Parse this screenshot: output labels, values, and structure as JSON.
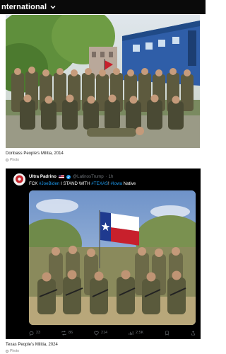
{
  "header": {
    "title": "nternational"
  },
  "post1": {
    "caption": "Donbass People's Militia, 2014",
    "type_label": "Photo"
  },
  "tweet": {
    "display_name": "Ultra Padrino",
    "handle": "@LatinosTrump",
    "time": "· 1h",
    "text_prefix": "FCK ",
    "tag1": "#JoeBiden",
    "text_mid": " I STAND WITH ",
    "tag2": "#TEXAS",
    "text_mid2": "! ",
    "tag3": "#Iowa",
    "text_suffix": " Native",
    "replies": "23",
    "reposts": "86",
    "likes": "214",
    "views": "2.5K"
  },
  "post2": {
    "caption": "Texas People's Militia, 2024",
    "type_label": "Photo"
  },
  "colors": {
    "link": "#1d9bf0",
    "tweet_bg": "#000000"
  }
}
